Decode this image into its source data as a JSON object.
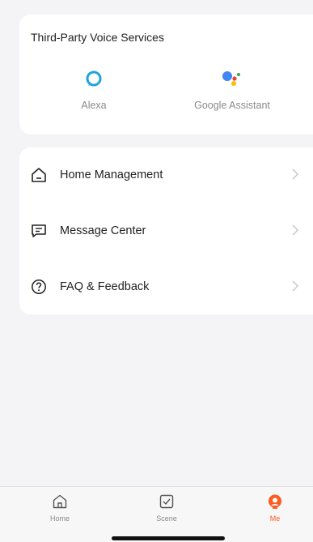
{
  "voice_services": {
    "title": "Third-Party Voice Services",
    "items": [
      {
        "label": "Alexa",
        "icon": "alexa-ring-icon",
        "color": "#1fa3e0"
      },
      {
        "label": "Google Assistant",
        "icon": "google-assistant-icon"
      }
    ]
  },
  "menu": {
    "items": [
      {
        "label": "Home Management",
        "icon": "home-outline-icon"
      },
      {
        "label": "Message Center",
        "icon": "message-icon"
      },
      {
        "label": "FAQ & Feedback",
        "icon": "question-circle-icon"
      }
    ]
  },
  "tab_bar": {
    "tabs": [
      {
        "label": "Home",
        "icon": "home-icon",
        "active": false
      },
      {
        "label": "Scene",
        "icon": "checkbox-icon",
        "active": false
      },
      {
        "label": "Me",
        "icon": "user-icon",
        "active": true
      }
    ],
    "accent_color": "#ff5a1f"
  }
}
